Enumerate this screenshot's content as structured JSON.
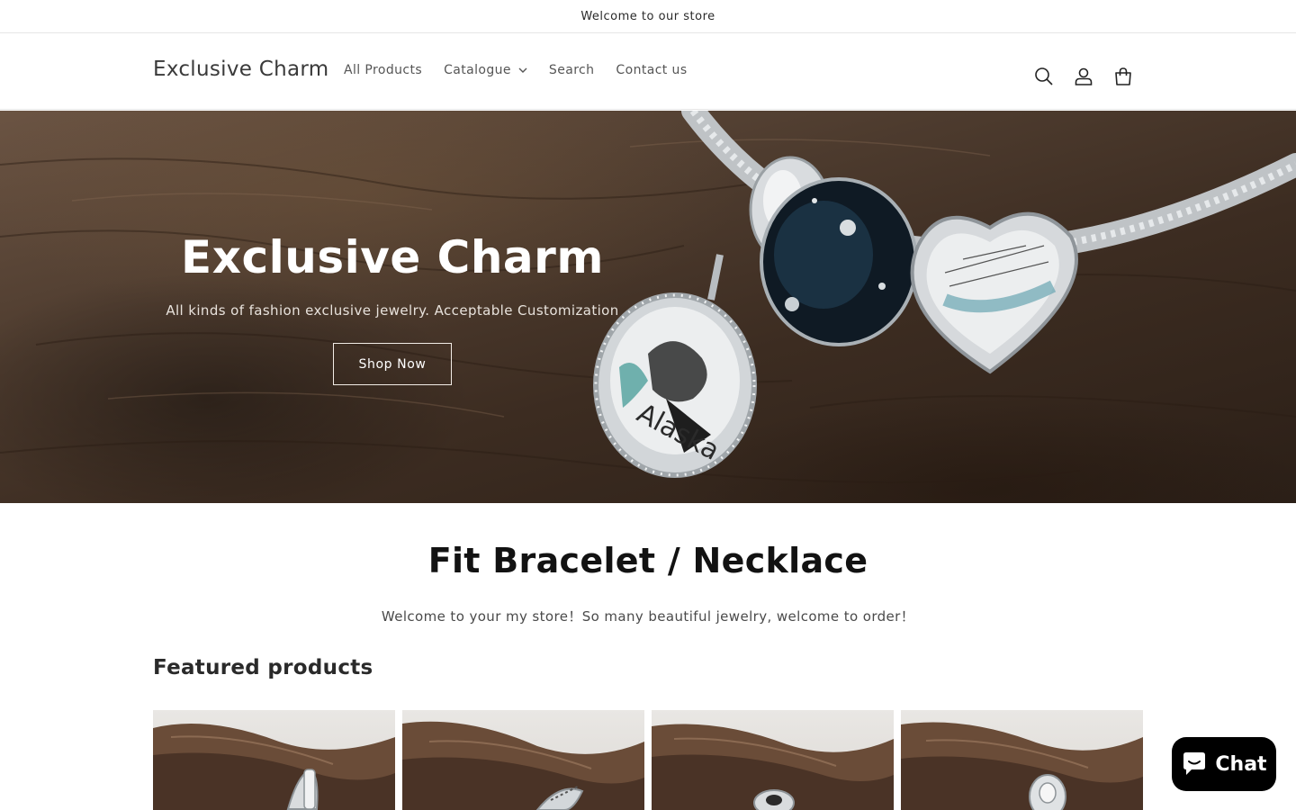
{
  "announcement": {
    "text": "Welcome to our store"
  },
  "header": {
    "logo": "Exclusive Charm",
    "nav": [
      {
        "label": "All Products"
      },
      {
        "label": "Catalogue"
      },
      {
        "label": "Search"
      },
      {
        "label": "Contact us"
      }
    ],
    "icons": [
      "search-icon",
      "account-icon",
      "cart-icon"
    ]
  },
  "hero": {
    "title": "Exclusive Charm",
    "subtitle": "All kinds of fashion exclusive jewelry. Acceptable Customization",
    "button": "Shop Now",
    "pendant_text": "Alaska"
  },
  "collection": {
    "title": "Fit Bracelet / Necklace",
    "subtitle": "Welcome to your my store！So many beautiful jewelry, welcome to order！"
  },
  "featured": {
    "heading": "Featured products",
    "products": [
      {},
      {},
      {},
      {}
    ]
  },
  "chat": {
    "label": "Chat",
    "icon": "chat-bubble-icon"
  },
  "colors": {
    "text": "#121212",
    "border": "#e6e6e6",
    "chat_bg": "#000000",
    "hero_bg": "#4d3b2e"
  }
}
